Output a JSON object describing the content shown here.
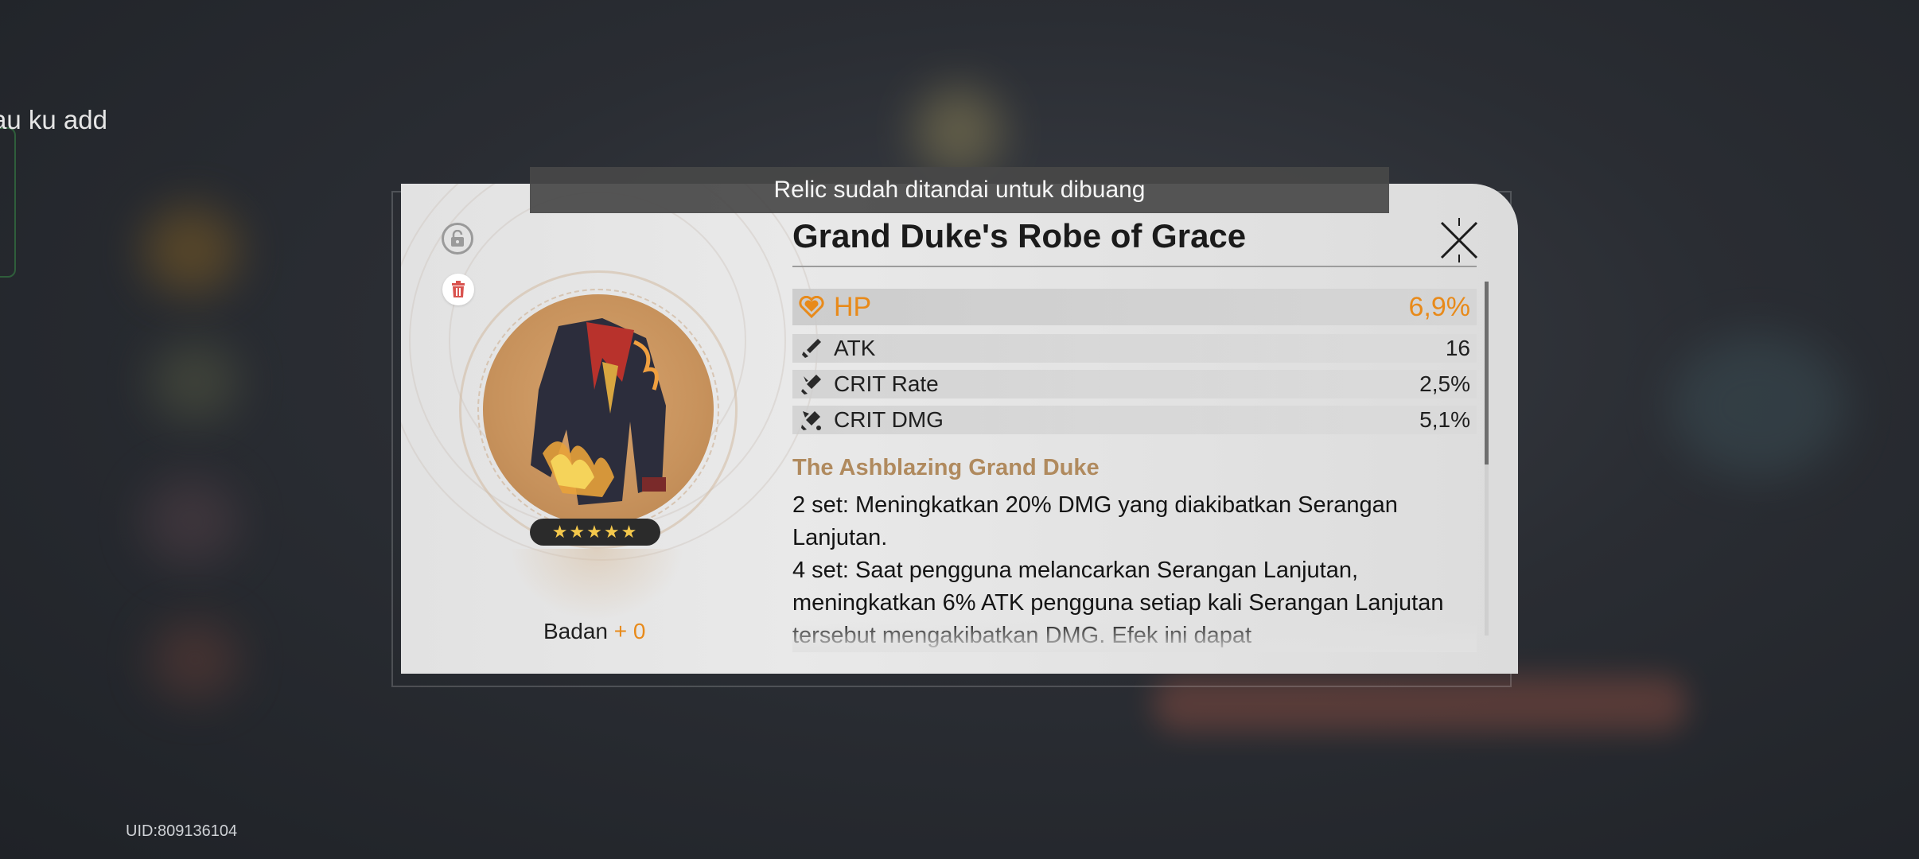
{
  "background": {
    "chat_fragment": "au ku add",
    "uid": "UID:809136104"
  },
  "toast": {
    "message": "Relic sudah ditandai untuk dibuang"
  },
  "relic": {
    "name": "Grand Duke's Robe of Grace",
    "rarity_stars": "★★★★★",
    "rarity": 5,
    "slot": "Badan",
    "level": "+ 0",
    "locked": false,
    "marked_for_discard": true,
    "main_stat": {
      "name": "HP",
      "value": "6,9%",
      "icon": "hp-icon"
    },
    "sub_stats": [
      {
        "name": "ATK",
        "value": "16",
        "icon": "atk-icon"
      },
      {
        "name": "CRIT Rate",
        "value": "2,5%",
        "icon": "crit-rate-icon"
      },
      {
        "name": "CRIT DMG",
        "value": "5,1%",
        "icon": "crit-dmg-icon"
      }
    ],
    "set": {
      "name": "The Ashblazing Grand Duke",
      "two_piece": "2 set: Meningkatkan 20% DMG yang diakibatkan Serangan Lanjutan.",
      "four_piece": "4 set: Saat pengguna melancarkan Serangan Lanjutan, meningkatkan 6% ATK pengguna setiap kali Serangan Lanjutan tersebut mengakibatkan DMG. Efek ini dapat"
    }
  },
  "colors": {
    "accent_orange": "#e88a1a",
    "set_name": "#b08a5e",
    "trash_red": "#d9534f"
  }
}
